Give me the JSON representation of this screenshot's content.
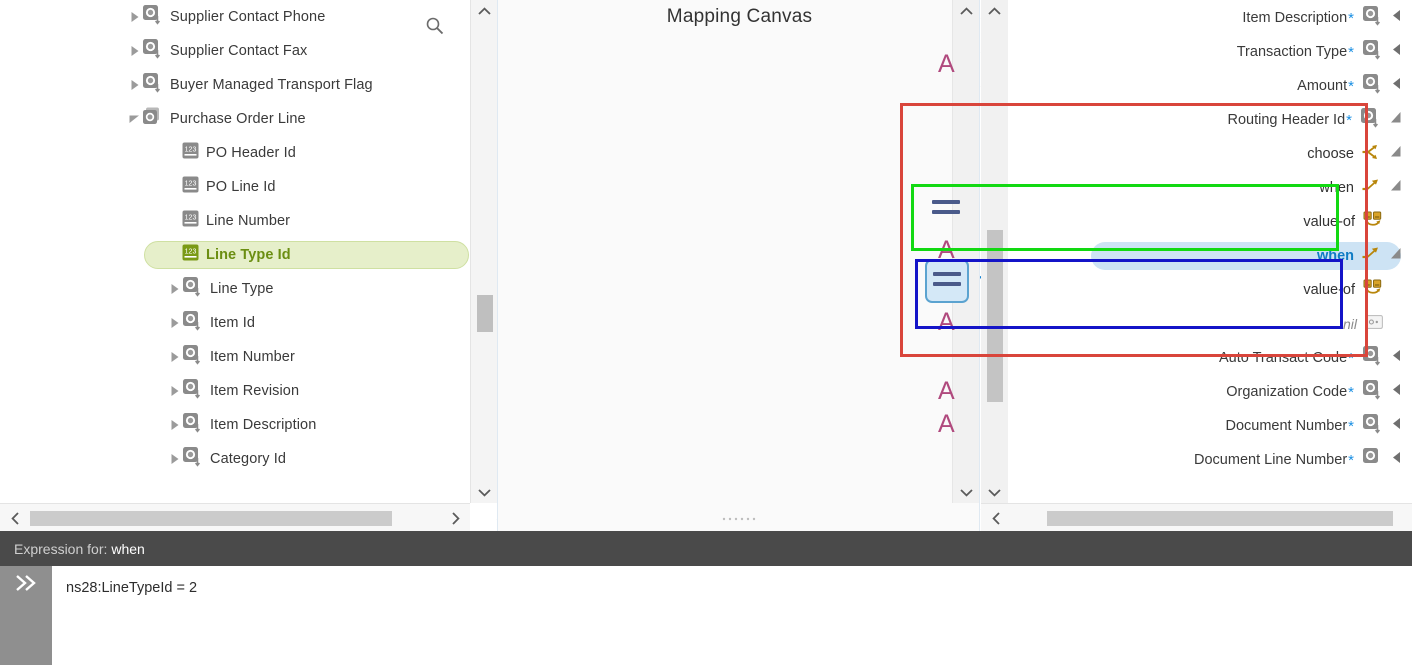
{
  "canvas": {
    "title": "Mapping Canvas"
  },
  "source_tree": {
    "search_icon": "search-icon",
    "items": [
      {
        "label": "Supplier Contact Phone",
        "icon": "attribute-icon",
        "indent": 0,
        "twisty": "collapsed",
        "selected": false
      },
      {
        "label": "Supplier Contact Fax",
        "icon": "attribute-icon",
        "indent": 0,
        "twisty": "collapsed",
        "selected": false
      },
      {
        "label": "Buyer Managed Transport Flag",
        "icon": "element-icon",
        "indent": 0,
        "twisty": "collapsed",
        "selected": false
      },
      {
        "label": "Purchase Order Line",
        "icon": "repeating-icon",
        "indent": 0,
        "twisty": "expanded",
        "selected": false
      },
      {
        "label": "PO Header Id",
        "icon": "number-icon",
        "indent": 1,
        "twisty": "none",
        "selected": false
      },
      {
        "label": "PO Line Id",
        "icon": "number-icon",
        "indent": 1,
        "twisty": "none",
        "selected": false
      },
      {
        "label": "Line Number",
        "icon": "number-icon",
        "indent": 1,
        "twisty": "none",
        "selected": false
      },
      {
        "label": "Line Type Id",
        "icon": "number-icon",
        "indent": 1,
        "twisty": "none",
        "selected": true
      },
      {
        "label": "Line Type",
        "icon": "attribute-icon",
        "indent": 1,
        "twisty": "collapsed",
        "selected": false
      },
      {
        "label": "Item Id",
        "icon": "attribute-icon",
        "indent": 1,
        "twisty": "collapsed",
        "selected": false
      },
      {
        "label": "Item Number",
        "icon": "attribute-icon",
        "indent": 1,
        "twisty": "collapsed",
        "selected": false
      },
      {
        "label": "Item Revision",
        "icon": "attribute-icon",
        "indent": 1,
        "twisty": "collapsed",
        "selected": false
      },
      {
        "label": "Item Description",
        "icon": "attribute-icon",
        "indent": 1,
        "twisty": "collapsed",
        "selected": false
      },
      {
        "label": "Category Id",
        "icon": "attribute-icon",
        "indent": 1,
        "twisty": "collapsed",
        "selected": false
      }
    ]
  },
  "target_tree": {
    "items": [
      {
        "label": "Item Description",
        "required": true,
        "icon": "element-icon",
        "caret": "left",
        "selected": false,
        "kind": "field"
      },
      {
        "label": "Transaction Type",
        "required": true,
        "icon": "element-icon",
        "caret": "left",
        "selected": false,
        "kind": "field"
      },
      {
        "label": "Amount",
        "required": true,
        "icon": "element-icon",
        "caret": "left",
        "selected": false,
        "kind": "field"
      },
      {
        "label": "Routing Header Id",
        "required": true,
        "icon": "element-icon",
        "caret": "diagonal",
        "selected": false,
        "kind": "field"
      },
      {
        "label": "choose",
        "required": false,
        "icon": "choose-icon",
        "caret": "diagonal",
        "selected": false,
        "kind": "op"
      },
      {
        "label": "when",
        "required": false,
        "icon": "when-icon",
        "caret": "diagonal",
        "selected": false,
        "kind": "op"
      },
      {
        "label": "value-of",
        "required": false,
        "icon": "value-of-icon",
        "caret": "none",
        "selected": false,
        "kind": "op"
      },
      {
        "label": "when",
        "required": false,
        "icon": "when-icon",
        "caret": "diagonal",
        "selected": true,
        "kind": "op"
      },
      {
        "label": "value-of",
        "required": false,
        "icon": "value-of-icon",
        "caret": "none",
        "selected": false,
        "kind": "op"
      },
      {
        "label": "nil",
        "required": false,
        "icon": "nil-icon",
        "caret": "none",
        "selected": false,
        "kind": "nil"
      },
      {
        "label": "Auto Transact Code",
        "required": true,
        "icon": "element-icon",
        "caret": "left",
        "selected": false,
        "kind": "field"
      },
      {
        "label": "Organization Code",
        "required": true,
        "icon": "element-icon",
        "caret": "left",
        "selected": false,
        "kind": "field"
      },
      {
        "label": "Document Number",
        "required": true,
        "icon": "element-icon",
        "caret": "left",
        "selected": false,
        "kind": "field"
      },
      {
        "label": "Document Line Number",
        "required": true,
        "icon": "element-icon2",
        "caret": "left",
        "selected": false,
        "kind": "field"
      }
    ]
  },
  "annotations": [
    {
      "name": "red-outline",
      "color": "#d9453b"
    },
    {
      "name": "green-outline",
      "color": "#12d912"
    },
    {
      "name": "blue-outline",
      "color": "#1414c8"
    }
  ],
  "expression": {
    "header_prefix": "Expression for:",
    "header_target": "when",
    "value": "ns28:LineTypeId = 2",
    "placeholder": "",
    "expand_icon": "double-chevron-right-icon"
  },
  "scrollbars": {
    "up_icon": "chevron-up-icon",
    "down_icon": "chevron-down-icon",
    "left_icon": "chevron-left-icon",
    "right_icon": "chevron-right-icon"
  },
  "colors": {
    "source_selected_text": "#6b8e12",
    "source_selected_bg": "#e6efca",
    "target_selected_text": "#0f7cc4",
    "target_selected_bg": "#cde3f4",
    "required_star": "#1a8fe3",
    "link_line": "#1483d4",
    "glyph_letter": "#b04a7e",
    "expr_header_bg": "#4a4a4a"
  }
}
